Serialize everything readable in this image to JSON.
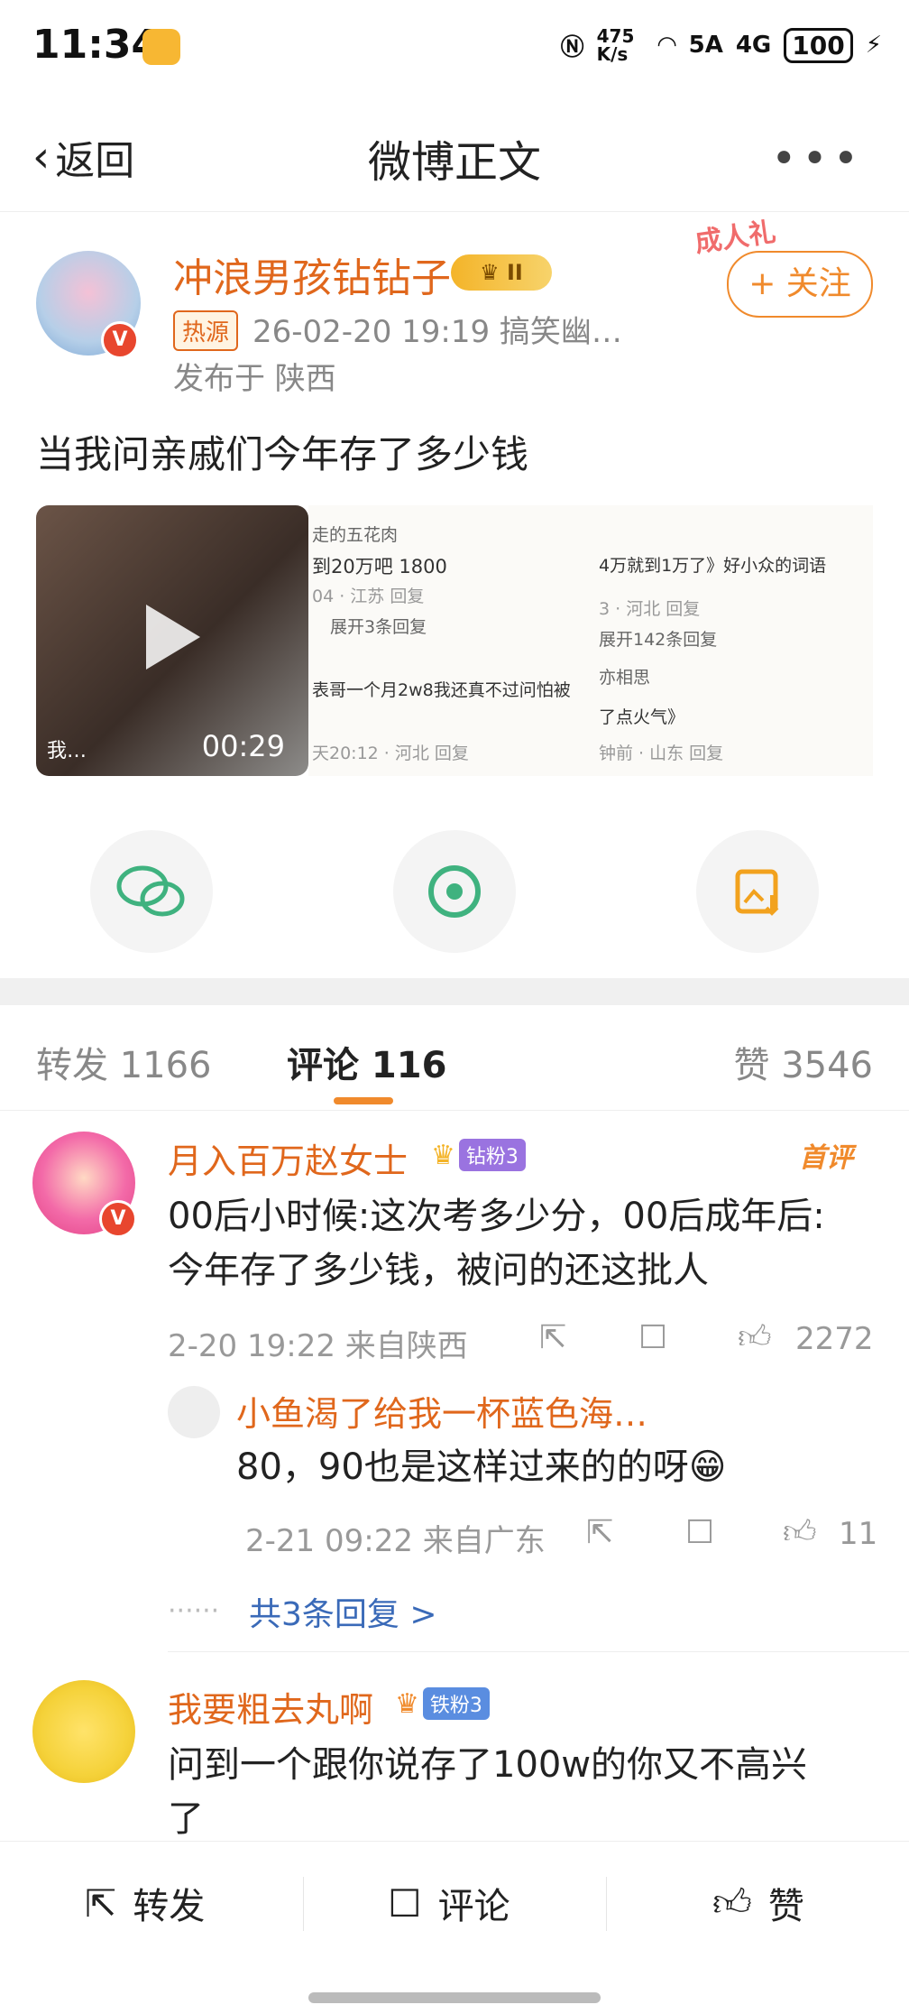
{
  "status": {
    "time": "11:34",
    "net_speed": "475 K/s",
    "signal_a": "5A",
    "signal_b": "4G",
    "battery": "100"
  },
  "nav": {
    "back_label": "返回",
    "title": "微博正文"
  },
  "post": {
    "author": "冲浪男孩钻钻子",
    "level_badge": "II",
    "hot_tag": "热源",
    "meta": "26-02-20 19:19  搞笑幽…",
    "location": "发布于 陕西",
    "follow_label": "+ 关注",
    "follow_decoration": "成人礼",
    "text": "当我问亲戚们今年存了多少钱",
    "video_duration": "00:29",
    "video_caption": "我…",
    "screenshot_lines": [
      "走的五花肉",
      "到20万吧 1800",
      "04 · 江苏    回复",
      "展开3条回复",
      "表哥一个月2w8我还真不过问怕被",
      "天20:12 · 河北    回复",
      "4万就到1万了》好小众的词语",
      "3 · 河北    回复",
      "展开142条回复",
      "亦相思",
      "了点火气》",
      "钟前 · 山东    回复"
    ]
  },
  "share": {
    "wechat_icon": "wechat-icon",
    "moments_icon": "moments-icon",
    "save_icon": "save-image-icon"
  },
  "tabs": {
    "repost": "转发 1166",
    "comment": "评论 116",
    "like": "赞 3546"
  },
  "comments": [
    {
      "name": "月入百万赵女士",
      "fan_badge": "钻粉3",
      "tag": "首评",
      "text_line1": "00后小时候:这次考多少分，00后成年后:",
      "text_line2": "今年存了多少钱，被问的还这批人",
      "meta": "2-20 19:22 来自陕西",
      "likes": "2272",
      "reply": {
        "name": "小鱼渴了给我一杯蓝色海…",
        "text": "80，90也是这样过来的的呀😁",
        "meta": "2-21 09:22 来自广东",
        "likes": "11"
      },
      "more_replies": "共3条回复 >"
    },
    {
      "name": "我要粗去丸啊",
      "fan_badge": "铁粉3",
      "text_line1": "问到一个跟你说存了100w的你又不高兴",
      "text_line2": "了"
    }
  ],
  "bottom": {
    "repost": "转发",
    "comment": "评论",
    "like": "赞"
  }
}
